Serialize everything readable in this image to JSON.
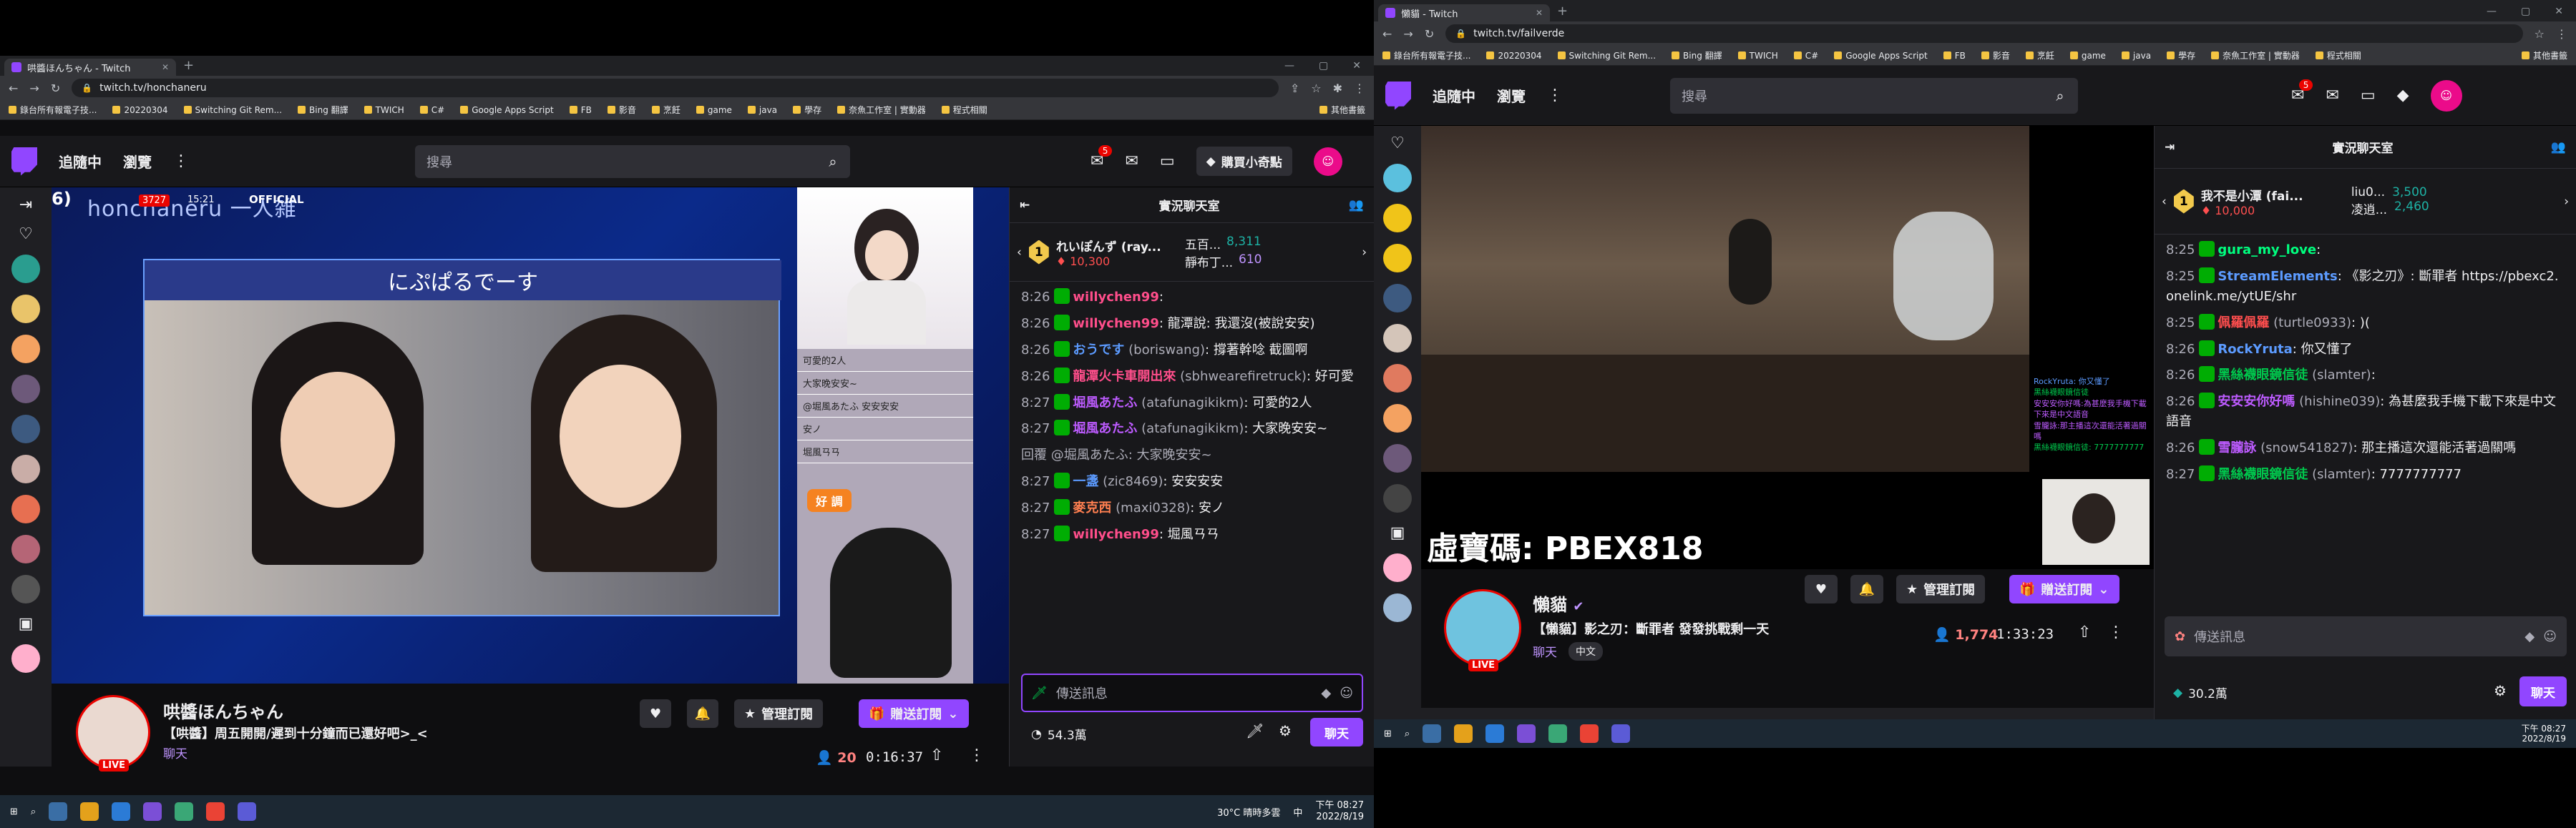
{
  "left": {
    "browser": {
      "tab_title": "哄醬ほんちゃん - Twitch",
      "url": "twitch.tv/honchaneru",
      "bookmarks": [
        "錄台所有報電子技...",
        "20220304",
        "Switching Git Rem...",
        "Bing 翻譯",
        "TWICH",
        "C#",
        "Google Apps Script",
        "FB",
        "影音",
        "烹飪",
        "game",
        "java",
        "學存",
        "奈魚工作室 | 實動器",
        "程式相關"
      ],
      "other_bookmarks": "其他書籤"
    },
    "nav": {
      "following": "追隨中",
      "browse": "瀏覽",
      "search_placeholder": "搜尋",
      "notif_count": "5",
      "buy_bits": "購買小奇點"
    },
    "video": {
      "overlay_title": "honchaneru 一人雑",
      "overlay_count": "3727",
      "overlay_time": "15:21",
      "overlay_official": "OFFICIAL",
      "banner": "にぷぱるでーす",
      "side_chat": [
        "可愛的2人",
        "大家晚安安~",
        "@堀風あたふ 安安安安",
        "安ノ",
        "堀風ㄢㄢ"
      ],
      "good_label": "好 調",
      "number_tag": "6)"
    },
    "info": {
      "channel": "哄醬ほんちゃん",
      "title": "【哄醬】周五開開/遲到十分鐘而已還好吧>_<",
      "category": "聊天",
      "viewers": "20",
      "uptime": "0:16:37",
      "manage_sub": "管理訂閱",
      "gift_sub": "贈送訂閱",
      "live": "LIVE"
    },
    "chat": {
      "header": "實況聊天室",
      "leaders": [
        {
          "rank": "1",
          "name": "れいぽんず (ray...",
          "bits": "10,300"
        },
        {
          "rank": "",
          "name": "五百...",
          "bits": "8,311"
        },
        {
          "rank": "",
          "name": "靜布丁...",
          "bits": "610"
        }
      ],
      "messages": [
        {
          "time": "8:26",
          "user": "willychen99",
          "login": "",
          "text": "",
          "color": "#ff4e8b"
        },
        {
          "time": "8:26",
          "user": "willychen99",
          "login": "",
          "text": "龍潭說: 我還沒(被說安安)",
          "color": "#ff4e8b"
        },
        {
          "time": "8:26",
          "user": "おうです",
          "login": "(boriswang)",
          "text": "撐著幹唸 截圖啊",
          "color": "#5c9bff"
        },
        {
          "time": "8:26",
          "user": "龍潭火卡車開出來",
          "login": "(sbhwearefiretruck)",
          "text": "好可愛",
          "color": "#ff4e8b"
        },
        {
          "time": "8:27",
          "user": "堀風あたふ",
          "login": "(atafunagikikm)",
          "text": "可愛的2人",
          "color": "#bd5bff"
        },
        {
          "time": "8:27",
          "user": "堀風あたふ",
          "login": "(atafunagikikm)",
          "text": "大家晚安安~",
          "color": "#bd5bff"
        },
        {
          "time": "",
          "user": "",
          "login": "",
          "text": "回覆 @堀風あたふ: 大家晚安安~",
          "color": "#adadb8"
        },
        {
          "time": "8:27",
          "user": "一盞",
          "login": "(zic8469)",
          "text": "安安安安",
          "color": "#5c9bff"
        },
        {
          "time": "8:27",
          "user": "麥克西",
          "login": "(maxi0328)",
          "text": "安ノ",
          "color": "#ff7f50"
        },
        {
          "time": "8:27",
          "user": "willychen99",
          "login": "",
          "text": "堀風ㄢㄢ",
          "color": "#ff4e8b"
        }
      ],
      "input_placeholder": "傳送訊息",
      "points": "54.3萬",
      "chat_button": "聊天"
    },
    "taskbar": {
      "weather": "30°C 晴時多雲",
      "time": "下午 08:27",
      "date": "2022/8/19",
      "lang": "中"
    }
  },
  "right": {
    "browser": {
      "tab_title": "懶貓 - Twitch",
      "url": "twitch.tv/failverde",
      "bookmarks": [
        "錄台所有報電子技...",
        "20220304",
        "Switching Git Rem...",
        "Bing 翻譯",
        "TWICH",
        "C#",
        "Google Apps Script",
        "FB",
        "影音",
        "烹飪",
        "game",
        "java",
        "學存",
        "奈魚工作室 | 實動器",
        "程式相關"
      ],
      "other_bookmarks": "其他書籤"
    },
    "nav": {
      "following": "追隨中",
      "browse": "瀏覽",
      "search_placeholder": "搜尋",
      "notif_count": "5"
    },
    "video": {
      "code_text": "虛寶碼: PBEX818",
      "game_chat": [
        "RockYruta: 你又懂了",
        "黑絲襪眼鏡信徒",
        "安安安你好嗎:為甚麼我手機下載下來是中文語音",
        "雪朧詠:那主播這次還能活著過關嗎",
        "黑絲襪眼鏡信徒: 7777777777"
      ]
    },
    "info": {
      "channel": "懶貓",
      "title": "【懶貓】影之刃：斷罪者 發發挑戰剩一天",
      "category": "聊天",
      "tag": "中文",
      "viewers": "1,774",
      "uptime": "1:33:23",
      "manage_sub": "管理訂閱",
      "gift_sub": "贈送訂閱",
      "live": "LIVE"
    },
    "chat": {
      "header": "實況聊天室",
      "leaders": [
        {
          "rank": "1",
          "name": "我不是小潭 (fai...",
          "bits": "10,000"
        },
        {
          "rank": "",
          "name": "liu0...",
          "bits": "3,500"
        },
        {
          "rank": "",
          "name": "凌逍...",
          "bits": "2,460"
        }
      ],
      "messages": [
        {
          "time": "8:25",
          "user": "gura_my_love",
          "login": "",
          "text": "",
          "color": "#00ff7f"
        },
        {
          "time": "8:25",
          "user": "StreamElements",
          "login": "",
          "text": "《影之刃》: 斷罪者 https://pbexc2.onelink.me/ytUE/shr",
          "color": "#5c9bff"
        },
        {
          "time": "8:25",
          "user": "佩羅佩羅",
          "login": "(turtle0933)",
          "text": ")(",
          "color": "#ff4e4e"
        },
        {
          "time": "8:26",
          "user": "RockYruta",
          "login": "",
          "text": "你又懂了",
          "color": "#5c9bff"
        },
        {
          "time": "8:26",
          "user": "黑絲襪眼鏡信徒",
          "login": "(slamter)",
          "text": "",
          "color": "#00c94d"
        },
        {
          "time": "8:26",
          "user": "安安安你好嗎",
          "login": "(hishine039)",
          "text": "為甚麼我手機下載下來是中文語音",
          "color": "#bd5bff"
        },
        {
          "time": "8:26",
          "user": "雪朧詠",
          "login": "(snow541827)",
          "text": "那主播這次還能活著過關嗎",
          "color": "#bd5bff"
        },
        {
          "time": "8:27",
          "user": "黑絲襪眼鏡信徒",
          "login": "(slamter)",
          "text": "7777777777",
          "color": "#00c94d"
        }
      ],
      "input_placeholder": "傳送訊息",
      "points": "30.2萬",
      "chat_button": "聊天"
    },
    "taskbar": {
      "time": "下午 08:27",
      "date": "2022/8/19"
    }
  }
}
